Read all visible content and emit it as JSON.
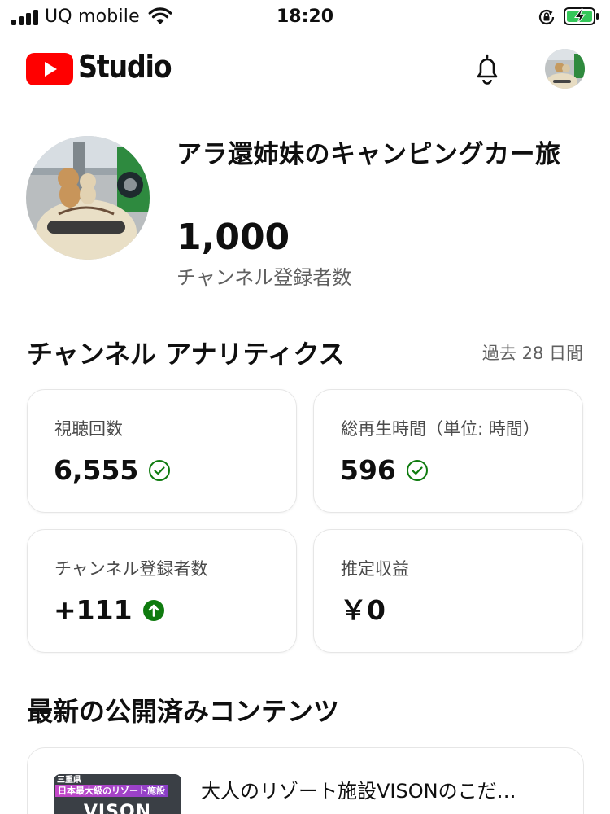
{
  "status_bar": {
    "carrier": "UQ mobile",
    "time": "18:20",
    "signal_icon": "cellular-signal-icon",
    "wifi_icon": "wifi-icon",
    "rotation_lock_icon": "rotation-lock-icon",
    "battery_icon": "battery-charging-icon",
    "battery_color": "#34c759"
  },
  "header": {
    "logo_word": "Studio",
    "logo_color": "#ff0000",
    "notifications_icon": "bell-icon"
  },
  "channel": {
    "name": "アラ還姉妹のキャンピングカー旅",
    "subscriber_count": "1,000",
    "subscriber_label": "チャンネル登録者数"
  },
  "analytics": {
    "title": "チャンネル アナリティクス",
    "period": "過去 28 日間",
    "cards": [
      {
        "label": "視聴回数",
        "value": "6,555",
        "icon": "check-circle-icon"
      },
      {
        "label": "総再生時間（単位: 時間）",
        "value": "596",
        "icon": "check-circle-icon"
      },
      {
        "label": "チャンネル登録者数",
        "value": "+111",
        "icon": "arrow-up-circle-icon"
      },
      {
        "label": "推定収益",
        "value": "￥0"
      }
    ],
    "status_green": "#0f7b0f"
  },
  "latest": {
    "title": "最新の公開済みコンテンツ",
    "video": {
      "title": "大人のリゾート施設VISONのこだ…",
      "thumbnail_tag": "三重県",
      "thumbnail_banner": "日本最大級のリゾート施設",
      "thumbnail_word": "VISON"
    }
  }
}
